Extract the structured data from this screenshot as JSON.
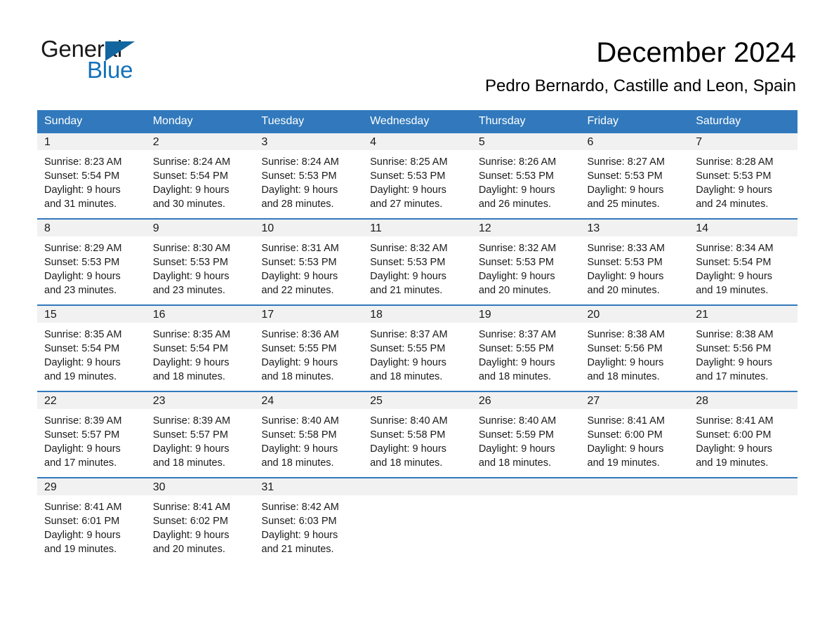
{
  "logo": {
    "word1": "General",
    "word2": "Blue",
    "triangle_color": "#12659f",
    "blue_color": "#1471b8"
  },
  "header": {
    "title": "December 2024",
    "subtitle": "Pedro Bernardo, Castille and Leon, Spain"
  },
  "theme": {
    "header_blue": "#3179bc",
    "daynum_band": "#f1f1f1",
    "week_separator": "#3179bc"
  },
  "calendar": {
    "weekday_headers": [
      "Sunday",
      "Monday",
      "Tuesday",
      "Wednesday",
      "Thursday",
      "Friday",
      "Saturday"
    ],
    "weeks": [
      [
        {
          "day": "1",
          "sunrise": "Sunrise: 8:23 AM",
          "sunset": "Sunset: 5:54 PM",
          "daylight1": "Daylight: 9 hours",
          "daylight2": "and 31 minutes."
        },
        {
          "day": "2",
          "sunrise": "Sunrise: 8:24 AM",
          "sunset": "Sunset: 5:54 PM",
          "daylight1": "Daylight: 9 hours",
          "daylight2": "and 30 minutes."
        },
        {
          "day": "3",
          "sunrise": "Sunrise: 8:24 AM",
          "sunset": "Sunset: 5:53 PM",
          "daylight1": "Daylight: 9 hours",
          "daylight2": "and 28 minutes."
        },
        {
          "day": "4",
          "sunrise": "Sunrise: 8:25 AM",
          "sunset": "Sunset: 5:53 PM",
          "daylight1": "Daylight: 9 hours",
          "daylight2": "and 27 minutes."
        },
        {
          "day": "5",
          "sunrise": "Sunrise: 8:26 AM",
          "sunset": "Sunset: 5:53 PM",
          "daylight1": "Daylight: 9 hours",
          "daylight2": "and 26 minutes."
        },
        {
          "day": "6",
          "sunrise": "Sunrise: 8:27 AM",
          "sunset": "Sunset: 5:53 PM",
          "daylight1": "Daylight: 9 hours",
          "daylight2": "and 25 minutes."
        },
        {
          "day": "7",
          "sunrise": "Sunrise: 8:28 AM",
          "sunset": "Sunset: 5:53 PM",
          "daylight1": "Daylight: 9 hours",
          "daylight2": "and 24 minutes."
        }
      ],
      [
        {
          "day": "8",
          "sunrise": "Sunrise: 8:29 AM",
          "sunset": "Sunset: 5:53 PM",
          "daylight1": "Daylight: 9 hours",
          "daylight2": "and 23 minutes."
        },
        {
          "day": "9",
          "sunrise": "Sunrise: 8:30 AM",
          "sunset": "Sunset: 5:53 PM",
          "daylight1": "Daylight: 9 hours",
          "daylight2": "and 23 minutes."
        },
        {
          "day": "10",
          "sunrise": "Sunrise: 8:31 AM",
          "sunset": "Sunset: 5:53 PM",
          "daylight1": "Daylight: 9 hours",
          "daylight2": "and 22 minutes."
        },
        {
          "day": "11",
          "sunrise": "Sunrise: 8:32 AM",
          "sunset": "Sunset: 5:53 PM",
          "daylight1": "Daylight: 9 hours",
          "daylight2": "and 21 minutes."
        },
        {
          "day": "12",
          "sunrise": "Sunrise: 8:32 AM",
          "sunset": "Sunset: 5:53 PM",
          "daylight1": "Daylight: 9 hours",
          "daylight2": "and 20 minutes."
        },
        {
          "day": "13",
          "sunrise": "Sunrise: 8:33 AM",
          "sunset": "Sunset: 5:53 PM",
          "daylight1": "Daylight: 9 hours",
          "daylight2": "and 20 minutes."
        },
        {
          "day": "14",
          "sunrise": "Sunrise: 8:34 AM",
          "sunset": "Sunset: 5:54 PM",
          "daylight1": "Daylight: 9 hours",
          "daylight2": "and 19 minutes."
        }
      ],
      [
        {
          "day": "15",
          "sunrise": "Sunrise: 8:35 AM",
          "sunset": "Sunset: 5:54 PM",
          "daylight1": "Daylight: 9 hours",
          "daylight2": "and 19 minutes."
        },
        {
          "day": "16",
          "sunrise": "Sunrise: 8:35 AM",
          "sunset": "Sunset: 5:54 PM",
          "daylight1": "Daylight: 9 hours",
          "daylight2": "and 18 minutes."
        },
        {
          "day": "17",
          "sunrise": "Sunrise: 8:36 AM",
          "sunset": "Sunset: 5:55 PM",
          "daylight1": "Daylight: 9 hours",
          "daylight2": "and 18 minutes."
        },
        {
          "day": "18",
          "sunrise": "Sunrise: 8:37 AM",
          "sunset": "Sunset: 5:55 PM",
          "daylight1": "Daylight: 9 hours",
          "daylight2": "and 18 minutes."
        },
        {
          "day": "19",
          "sunrise": "Sunrise: 8:37 AM",
          "sunset": "Sunset: 5:55 PM",
          "daylight1": "Daylight: 9 hours",
          "daylight2": "and 18 minutes."
        },
        {
          "day": "20",
          "sunrise": "Sunrise: 8:38 AM",
          "sunset": "Sunset: 5:56 PM",
          "daylight1": "Daylight: 9 hours",
          "daylight2": "and 18 minutes."
        },
        {
          "day": "21",
          "sunrise": "Sunrise: 8:38 AM",
          "sunset": "Sunset: 5:56 PM",
          "daylight1": "Daylight: 9 hours",
          "daylight2": "and 17 minutes."
        }
      ],
      [
        {
          "day": "22",
          "sunrise": "Sunrise: 8:39 AM",
          "sunset": "Sunset: 5:57 PM",
          "daylight1": "Daylight: 9 hours",
          "daylight2": "and 17 minutes."
        },
        {
          "day": "23",
          "sunrise": "Sunrise: 8:39 AM",
          "sunset": "Sunset: 5:57 PM",
          "daylight1": "Daylight: 9 hours",
          "daylight2": "and 18 minutes."
        },
        {
          "day": "24",
          "sunrise": "Sunrise: 8:40 AM",
          "sunset": "Sunset: 5:58 PM",
          "daylight1": "Daylight: 9 hours",
          "daylight2": "and 18 minutes."
        },
        {
          "day": "25",
          "sunrise": "Sunrise: 8:40 AM",
          "sunset": "Sunset: 5:58 PM",
          "daylight1": "Daylight: 9 hours",
          "daylight2": "and 18 minutes."
        },
        {
          "day": "26",
          "sunrise": "Sunrise: 8:40 AM",
          "sunset": "Sunset: 5:59 PM",
          "daylight1": "Daylight: 9 hours",
          "daylight2": "and 18 minutes."
        },
        {
          "day": "27",
          "sunrise": "Sunrise: 8:41 AM",
          "sunset": "Sunset: 6:00 PM",
          "daylight1": "Daylight: 9 hours",
          "daylight2": "and 19 minutes."
        },
        {
          "day": "28",
          "sunrise": "Sunrise: 8:41 AM",
          "sunset": "Sunset: 6:00 PM",
          "daylight1": "Daylight: 9 hours",
          "daylight2": "and 19 minutes."
        }
      ],
      [
        {
          "day": "29",
          "sunrise": "Sunrise: 8:41 AM",
          "sunset": "Sunset: 6:01 PM",
          "daylight1": "Daylight: 9 hours",
          "daylight2": "and 19 minutes."
        },
        {
          "day": "30",
          "sunrise": "Sunrise: 8:41 AM",
          "sunset": "Sunset: 6:02 PM",
          "daylight1": "Daylight: 9 hours",
          "daylight2": "and 20 minutes."
        },
        {
          "day": "31",
          "sunrise": "Sunrise: 8:42 AM",
          "sunset": "Sunset: 6:03 PM",
          "daylight1": "Daylight: 9 hours",
          "daylight2": "and 21 minutes."
        },
        {
          "day": "",
          "sunrise": "",
          "sunset": "",
          "daylight1": "",
          "daylight2": ""
        },
        {
          "day": "",
          "sunrise": "",
          "sunset": "",
          "daylight1": "",
          "daylight2": ""
        },
        {
          "day": "",
          "sunrise": "",
          "sunset": "",
          "daylight1": "",
          "daylight2": ""
        },
        {
          "day": "",
          "sunrise": "",
          "sunset": "",
          "daylight1": "",
          "daylight2": ""
        }
      ]
    ]
  }
}
